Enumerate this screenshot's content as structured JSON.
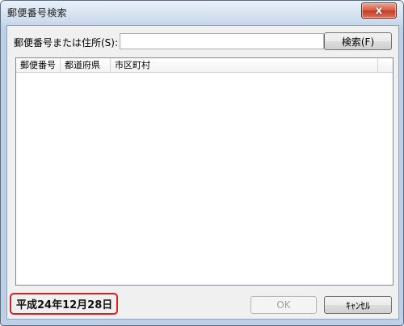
{
  "window": {
    "title": "郵便番号検索",
    "close_glyph": "x"
  },
  "search": {
    "label": "郵便番号または住所(S):",
    "value": "",
    "button_label": "検索(F)"
  },
  "results": {
    "columns": [
      "郵便番号",
      "都道府県",
      "市区町村"
    ],
    "rows": []
  },
  "footer": {
    "date_text": "平成24年12月28日",
    "ok_label": "OK",
    "ok_enabled": false,
    "cancel_label": "ｷｬﾝｾﾙ"
  },
  "colors": {
    "highlight_border": "#d91e1e",
    "close_button": "#c43c22",
    "window_frame": "#bdd0e6"
  },
  "icons": {
    "close": "close-icon"
  }
}
